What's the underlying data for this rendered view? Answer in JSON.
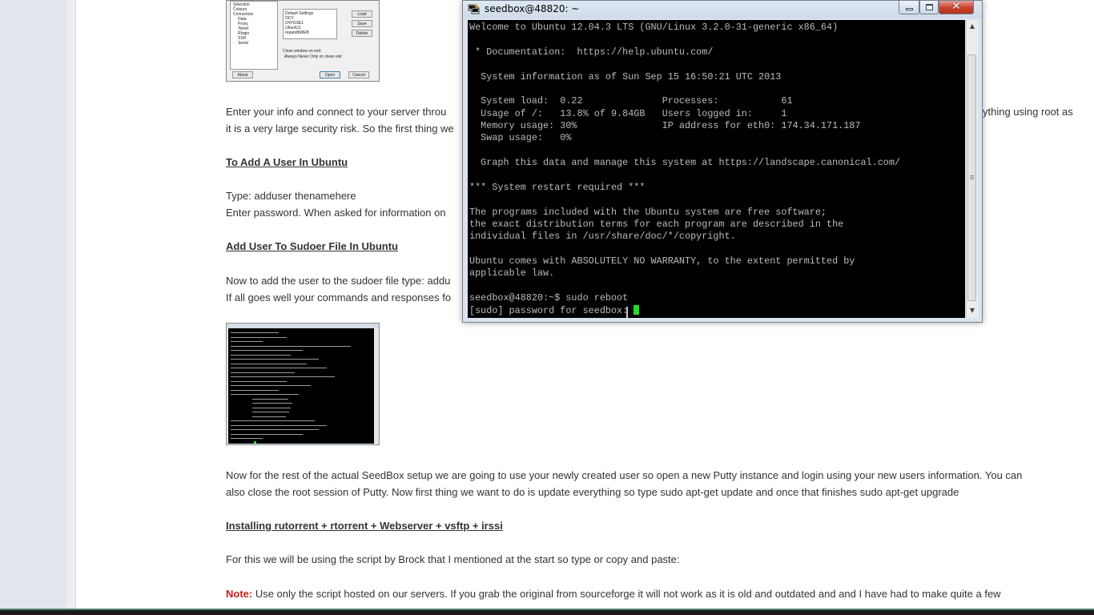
{
  "article": {
    "para_connect_1": "Enter your info and connect to your server throu",
    "para_connect_1_end": "ything using root as",
    "para_connect_2": "it is a very large security risk. So the first thing we",
    "heading_add_user": "To Add A User In Ubuntu",
    "type_adduser": "Type: adduser thenamehere",
    "enter_password": "Enter password. When asked for information on",
    "heading_sudoer": "Add User To Sudoer File In Ubuntu",
    "sudoer_line_1": "Now to add the user to the sudoer file type: addu",
    "sudoer_line_2": "If all goes well your commands and responses fo",
    "seedbox_para_1": "Now for the rest of the actual SeedBox setup we are going to use your newly created user so open a new Putty instance and login using your new users information. You can",
    "seedbox_para_2": "also close the root session of Putty. Now first thing we want to do is update everything so type sudo apt-get update and once that finishes sudo apt-get upgrade",
    "heading_install": "Installing rutorrent + rtorrent + Webserver + vsftp + irssi",
    "script_para": "For this we will be using the script by Brock that I mentioned at the start so type or copy and paste:",
    "note_label": "Note:",
    "note_text": " Use only the script hosted on our servers. If you grab the original from sourceforge it will not work as it is old and outdated and and I have had to make quite a few"
  },
  "config_thumb": {
    "tree": [
      "Selection",
      "Colours",
      "Connection",
      "Data",
      "Proxy",
      "Telnet",
      "Rlogin",
      "SSH",
      "Serial"
    ],
    "sessions": [
      "Default Settings",
      "OCY",
      "OVH1SE1",
      "UbuntU1",
      "repandbWEB"
    ],
    "buttons": {
      "load": "Load",
      "save": "Save",
      "delete": "Delete",
      "about": "About",
      "open": "Open",
      "cancel": "Cancel"
    },
    "close_label": "Close window on exit:",
    "close_opts": "Always    Never    Only on clean exit"
  },
  "putty": {
    "title": "seedbox@48820: ~",
    "lines": [
      "Welcome to Ubuntu 12.04.3 LTS (GNU/Linux 3.2.0-31-generic x86_64)",
      "",
      " * Documentation:  https://help.ubuntu.com/",
      "",
      "  System information as of Sun Sep 15 16:50:21 UTC 2013",
      "",
      "  System load:  0.22              Processes:           61",
      "  Usage of /:   13.8% of 9.84GB   Users logged in:     1",
      "  Memory usage: 30%               IP address for eth0: 174.34.171.187",
      "  Swap usage:   0%",
      "",
      "  Graph this data and manage this system at https://landscape.canonical.com/",
      "",
      "*** System restart required ***",
      "",
      "The programs included with the Ubuntu system are free software;",
      "the exact distribution terms for each program are described in the",
      "individual files in /usr/share/doc/*/copyright.",
      "",
      "Ubuntu comes with ABSOLUTELY NO WARRANTY, to the extent permitted by",
      "applicable law.",
      "",
      "seedbox@48820:~$ sudo reboot",
      "[sudo] password for seedbox: "
    ],
    "cursor_color": "#22dd22",
    "close_glyph": "✕",
    "scroll_up": "▲",
    "scroll_down": "▼"
  },
  "colors": {
    "note": "#c8201c",
    "terminal_bg": "#000000",
    "terminal_fg": "#bbbbbb"
  }
}
